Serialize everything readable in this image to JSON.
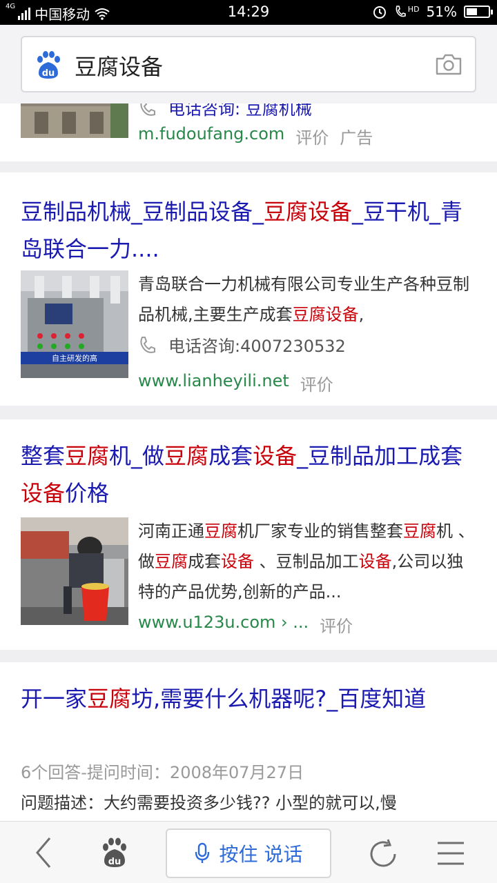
{
  "status_bar": {
    "network_type": "4G",
    "carrier": "中国移动",
    "time": "14:29",
    "hd_label": "HD",
    "battery_percent": "51%",
    "battery_level": 0.51
  },
  "search": {
    "query": "豆腐设备",
    "logo_text": "du"
  },
  "results": [
    {
      "phone_partial": "电话咨询: 豆腐机械",
      "url": "m.fudoufang.com",
      "rate": "评价",
      "ad": "广告"
    },
    {
      "title_segments": [
        {
          "t": "豆制品机械_豆制品设备_",
          "hl": false
        },
        {
          "t": "豆腐设备",
          "hl": true
        },
        {
          "t": "_豆干机_青岛联合一力....",
          "hl": false
        }
      ],
      "desc_segments": [
        {
          "t": "青岛联合一力机械有限公司专业生产各种豆制品机械,主要生产成套",
          "hl": false
        },
        {
          "t": "豆腐设备",
          "hl": true
        },
        {
          "t": ",",
          "hl": false
        }
      ],
      "phone": "电话咨询:4007230532",
      "url": "www.lianheyili.net",
      "rate": "评价",
      "thumb_caption": "自主研发的高"
    },
    {
      "title_segments": [
        {
          "t": "整套",
          "hl": false
        },
        {
          "t": "豆腐",
          "hl": true
        },
        {
          "t": "机_做",
          "hl": false
        },
        {
          "t": "豆腐",
          "hl": true
        },
        {
          "t": "成套",
          "hl": false
        },
        {
          "t": "设备",
          "hl": true
        },
        {
          "t": "_豆制品加工成套",
          "hl": false
        },
        {
          "t": "设备",
          "hl": true
        },
        {
          "t": "价格",
          "hl": false
        }
      ],
      "desc_segments": [
        {
          "t": "河南正通",
          "hl": false
        },
        {
          "t": "豆腐",
          "hl": true
        },
        {
          "t": "机厂家专业的销售整套",
          "hl": false
        },
        {
          "t": "豆腐",
          "hl": true
        },
        {
          "t": "机 、做",
          "hl": false
        },
        {
          "t": "豆腐",
          "hl": true
        },
        {
          "t": "成套",
          "hl": false
        },
        {
          "t": "设备",
          "hl": true
        },
        {
          "t": " 、豆制品加工",
          "hl": false
        },
        {
          "t": "设备",
          "hl": true
        },
        {
          "t": ",公司以独特的产品优势,创新的产品...",
          "hl": false
        }
      ],
      "url": "www.u123u.com › ...",
      "rate": "评价"
    },
    {
      "title_segments": [
        {
          "t": "开一家",
          "hl": false
        },
        {
          "t": "豆腐",
          "hl": true
        },
        {
          "t": "坊,需要什么机器呢?_百度知道",
          "hl": false
        }
      ],
      "meta": "6个回答-提问时间：2008年07月27日",
      "desc": "问题描述：大约需要投资多少钱?? 小型的就可以,慢"
    }
  ],
  "bottom_bar": {
    "back_icon": "chevron-left-icon",
    "home_icon": "baidu-paw-icon",
    "voice_label": "按住 说话",
    "refresh_icon": "refresh-icon",
    "menu_icon": "menu-icon"
  },
  "colors": {
    "title_blue": "#1a1ab0",
    "highlight_red": "#c8000a",
    "url_green": "#28884a",
    "baidu_blue": "#2d6bd8"
  }
}
